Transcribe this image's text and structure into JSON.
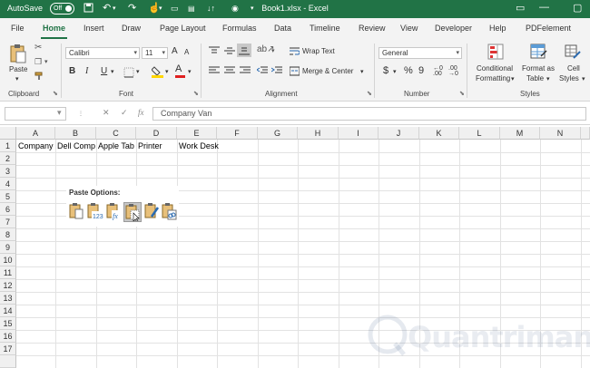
{
  "titlebar": {
    "autosave_label": "AutoSave",
    "autosave_state": "Off",
    "title": "Book1.xlsx  -  Excel"
  },
  "tabs": [
    "File",
    "Home",
    "Insert",
    "Draw",
    "Page Layout",
    "Formulas",
    "Data",
    "Timeline",
    "Review",
    "View",
    "Developer",
    "Help",
    "PDFelement"
  ],
  "active_tab": "Home",
  "ribbon": {
    "clipboard": {
      "paste": "Paste",
      "label": "Clipboard"
    },
    "font": {
      "name": "Calibri",
      "size": "11",
      "bold": "B",
      "italic": "I",
      "underline": "U",
      "grow": "A",
      "shrink": "A",
      "label": "Font"
    },
    "alignment": {
      "wrap": "Wrap Text",
      "merge": "Merge & Center",
      "label": "Alignment"
    },
    "number": {
      "format": "General",
      "currency": "$",
      "percent": "%",
      "comma": "9",
      "label": "Number"
    },
    "styles": {
      "conditional_1": "Conditional",
      "conditional_2": "Formatting",
      "format_table_1": "Format as",
      "format_table_2": "Table",
      "cell_styles_1": "Cell",
      "cell_styles_2": "Styles",
      "label": "Styles"
    }
  },
  "formula_bar": {
    "name_box": "",
    "fx": "fx",
    "value": "Company Van"
  },
  "columns": [
    "A",
    "B",
    "C",
    "D",
    "E",
    "F",
    "G",
    "H",
    "I",
    "J",
    "K",
    "L",
    "M",
    "N"
  ],
  "rows": [
    "1",
    "2",
    "3",
    "4",
    "5",
    "6",
    "7",
    "8",
    "9",
    "10",
    "11",
    "12",
    "13",
    "14",
    "15",
    "16",
    "17"
  ],
  "row1_cells": [
    "Company",
    "Dell Comp",
    "Apple Tab",
    "Printer",
    "Work Desk"
  ],
  "paste_options": {
    "title": "Paste Options:"
  },
  "watermark": "Quantrimang",
  "colors": {
    "brand": "#217346",
    "ribbon_bg": "#f3f3f3"
  }
}
